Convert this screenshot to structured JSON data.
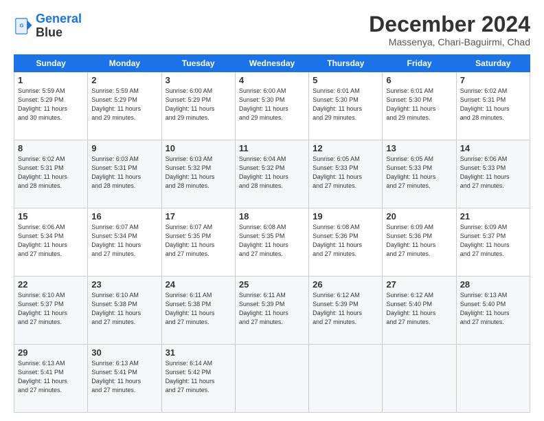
{
  "logo": {
    "line1": "General",
    "line2": "Blue"
  },
  "title": "December 2024",
  "subtitle": "Massenya, Chari-Baguirmi, Chad",
  "days_of_week": [
    "Sunday",
    "Monday",
    "Tuesday",
    "Wednesday",
    "Thursday",
    "Friday",
    "Saturday"
  ],
  "weeks": [
    [
      {
        "day": 1,
        "info": "Sunrise: 5:59 AM\nSunset: 5:29 PM\nDaylight: 11 hours\nand 30 minutes."
      },
      {
        "day": 2,
        "info": "Sunrise: 5:59 AM\nSunset: 5:29 PM\nDaylight: 11 hours\nand 29 minutes."
      },
      {
        "day": 3,
        "info": "Sunrise: 6:00 AM\nSunset: 5:29 PM\nDaylight: 11 hours\nand 29 minutes."
      },
      {
        "day": 4,
        "info": "Sunrise: 6:00 AM\nSunset: 5:30 PM\nDaylight: 11 hours\nand 29 minutes."
      },
      {
        "day": 5,
        "info": "Sunrise: 6:01 AM\nSunset: 5:30 PM\nDaylight: 11 hours\nand 29 minutes."
      },
      {
        "day": 6,
        "info": "Sunrise: 6:01 AM\nSunset: 5:30 PM\nDaylight: 11 hours\nand 29 minutes."
      },
      {
        "day": 7,
        "info": "Sunrise: 6:02 AM\nSunset: 5:31 PM\nDaylight: 11 hours\nand 28 minutes."
      }
    ],
    [
      {
        "day": 8,
        "info": "Sunrise: 6:02 AM\nSunset: 5:31 PM\nDaylight: 11 hours\nand 28 minutes."
      },
      {
        "day": 9,
        "info": "Sunrise: 6:03 AM\nSunset: 5:31 PM\nDaylight: 11 hours\nand 28 minutes."
      },
      {
        "day": 10,
        "info": "Sunrise: 6:03 AM\nSunset: 5:32 PM\nDaylight: 11 hours\nand 28 minutes."
      },
      {
        "day": 11,
        "info": "Sunrise: 6:04 AM\nSunset: 5:32 PM\nDaylight: 11 hours\nand 28 minutes."
      },
      {
        "day": 12,
        "info": "Sunrise: 6:05 AM\nSunset: 5:33 PM\nDaylight: 11 hours\nand 27 minutes."
      },
      {
        "day": 13,
        "info": "Sunrise: 6:05 AM\nSunset: 5:33 PM\nDaylight: 11 hours\nand 27 minutes."
      },
      {
        "day": 14,
        "info": "Sunrise: 6:06 AM\nSunset: 5:33 PM\nDaylight: 11 hours\nand 27 minutes."
      }
    ],
    [
      {
        "day": 15,
        "info": "Sunrise: 6:06 AM\nSunset: 5:34 PM\nDaylight: 11 hours\nand 27 minutes."
      },
      {
        "day": 16,
        "info": "Sunrise: 6:07 AM\nSunset: 5:34 PM\nDaylight: 11 hours\nand 27 minutes."
      },
      {
        "day": 17,
        "info": "Sunrise: 6:07 AM\nSunset: 5:35 PM\nDaylight: 11 hours\nand 27 minutes."
      },
      {
        "day": 18,
        "info": "Sunrise: 6:08 AM\nSunset: 5:35 PM\nDaylight: 11 hours\nand 27 minutes."
      },
      {
        "day": 19,
        "info": "Sunrise: 6:08 AM\nSunset: 5:36 PM\nDaylight: 11 hours\nand 27 minutes."
      },
      {
        "day": 20,
        "info": "Sunrise: 6:09 AM\nSunset: 5:36 PM\nDaylight: 11 hours\nand 27 minutes."
      },
      {
        "day": 21,
        "info": "Sunrise: 6:09 AM\nSunset: 5:37 PM\nDaylight: 11 hours\nand 27 minutes."
      }
    ],
    [
      {
        "day": 22,
        "info": "Sunrise: 6:10 AM\nSunset: 5:37 PM\nDaylight: 11 hours\nand 27 minutes."
      },
      {
        "day": 23,
        "info": "Sunrise: 6:10 AM\nSunset: 5:38 PM\nDaylight: 11 hours\nand 27 minutes."
      },
      {
        "day": 24,
        "info": "Sunrise: 6:11 AM\nSunset: 5:38 PM\nDaylight: 11 hours\nand 27 minutes."
      },
      {
        "day": 25,
        "info": "Sunrise: 6:11 AM\nSunset: 5:39 PM\nDaylight: 11 hours\nand 27 minutes."
      },
      {
        "day": 26,
        "info": "Sunrise: 6:12 AM\nSunset: 5:39 PM\nDaylight: 11 hours\nand 27 minutes."
      },
      {
        "day": 27,
        "info": "Sunrise: 6:12 AM\nSunset: 5:40 PM\nDaylight: 11 hours\nand 27 minutes."
      },
      {
        "day": 28,
        "info": "Sunrise: 6:13 AM\nSunset: 5:40 PM\nDaylight: 11 hours\nand 27 minutes."
      }
    ],
    [
      {
        "day": 29,
        "info": "Sunrise: 6:13 AM\nSunset: 5:41 PM\nDaylight: 11 hours\nand 27 minutes."
      },
      {
        "day": 30,
        "info": "Sunrise: 6:13 AM\nSunset: 5:41 PM\nDaylight: 11 hours\nand 27 minutes."
      },
      {
        "day": 31,
        "info": "Sunrise: 6:14 AM\nSunset: 5:42 PM\nDaylight: 11 hours\nand 27 minutes."
      },
      null,
      null,
      null,
      null
    ]
  ]
}
